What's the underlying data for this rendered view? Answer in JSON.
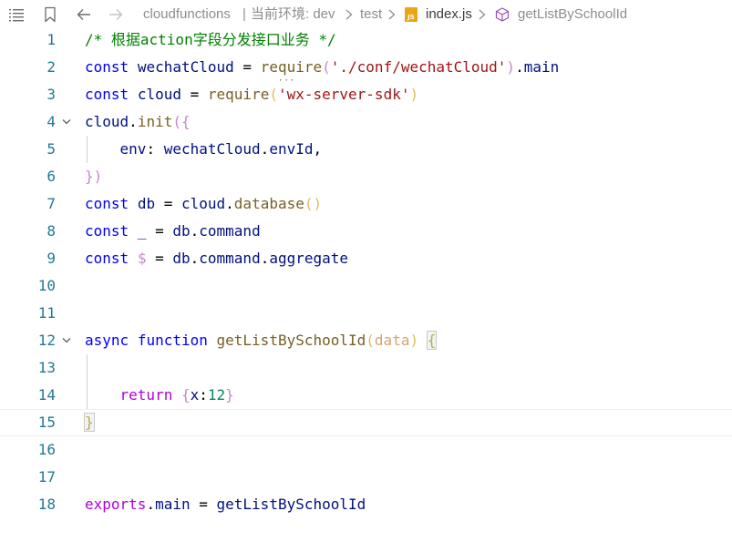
{
  "breadcrumb": {
    "project": "cloudfunctions",
    "separator_bar": "|",
    "env_label": "当前环境: dev",
    "folder": "test",
    "file_badge": "JS",
    "file": "index.js",
    "symbol": "getListBySchoolId"
  },
  "editor": {
    "current_line": 15,
    "lines": [
      {
        "num": "1",
        "tokens": [
          {
            "t": "/* 根据action字段分发接口业务 */",
            "c": "comment"
          }
        ]
      },
      {
        "num": "2",
        "tokens": [
          {
            "t": "const",
            "c": "kw"
          },
          {
            "t": " ",
            "c": "plain"
          },
          {
            "t": "wechatCloud",
            "c": "var"
          },
          {
            "t": " = ",
            "c": "plain"
          },
          {
            "t": "re",
            "c": "fn"
          },
          {
            "t": "q",
            "c": "fn",
            "ellipsis": true
          },
          {
            "t": "uire",
            "c": "fn"
          },
          {
            "t": "(",
            "c": "b5"
          },
          {
            "t": "'./conf/wechatCloud'",
            "c": "str"
          },
          {
            "t": ")",
            "c": "b5"
          },
          {
            "t": ".",
            "c": "plain"
          },
          {
            "t": "main",
            "c": "var"
          }
        ]
      },
      {
        "num": "3",
        "tokens": [
          {
            "t": "const",
            "c": "kw"
          },
          {
            "t": " ",
            "c": "plain"
          },
          {
            "t": "cloud",
            "c": "var"
          },
          {
            "t": " = ",
            "c": "plain"
          },
          {
            "t": "require",
            "c": "fn"
          },
          {
            "t": "(",
            "c": "b4"
          },
          {
            "t": "'wx-server-sdk'",
            "c": "str"
          },
          {
            "t": ")",
            "c": "b4"
          }
        ]
      },
      {
        "num": "4",
        "fold": true,
        "tokens": [
          {
            "t": "cloud",
            "c": "var"
          },
          {
            "t": ".",
            "c": "plain"
          },
          {
            "t": "init",
            "c": "fn"
          },
          {
            "t": "({",
            "c": "b5"
          }
        ]
      },
      {
        "num": "5",
        "guide": true,
        "tokens": [
          {
            "t": "    ",
            "c": "plain"
          },
          {
            "t": "env",
            "c": "var"
          },
          {
            "t": ": ",
            "c": "plain"
          },
          {
            "t": "wechatCloud",
            "c": "var"
          },
          {
            "t": ".",
            "c": "plain"
          },
          {
            "t": "envId",
            "c": "var"
          },
          {
            "t": ",",
            "c": "plain"
          }
        ]
      },
      {
        "num": "6",
        "tokens": [
          {
            "t": "})",
            "c": "b5"
          }
        ]
      },
      {
        "num": "7",
        "tokens": [
          {
            "t": "const",
            "c": "kw"
          },
          {
            "t": " ",
            "c": "plain"
          },
          {
            "t": "db",
            "c": "var"
          },
          {
            "t": " = ",
            "c": "plain"
          },
          {
            "t": "cloud",
            "c": "var"
          },
          {
            "t": ".",
            "c": "plain"
          },
          {
            "t": "database",
            "c": "fn"
          },
          {
            "t": "()",
            "c": "b4"
          }
        ]
      },
      {
        "num": "8",
        "tokens": [
          {
            "t": "const",
            "c": "kw"
          },
          {
            "t": " ",
            "c": "plain"
          },
          {
            "t": "_",
            "c": "var"
          },
          {
            "t": " = ",
            "c": "plain"
          },
          {
            "t": "db",
            "c": "var"
          },
          {
            "t": ".",
            "c": "plain"
          },
          {
            "t": "command",
            "c": "var"
          }
        ]
      },
      {
        "num": "9",
        "tokens": [
          {
            "t": "const",
            "c": "kw"
          },
          {
            "t": " ",
            "c": "plain"
          },
          {
            "t": "$",
            "c": "b5"
          },
          {
            "t": " = ",
            "c": "plain"
          },
          {
            "t": "db",
            "c": "var"
          },
          {
            "t": ".",
            "c": "plain"
          },
          {
            "t": "command",
            "c": "var"
          },
          {
            "t": ".",
            "c": "plain"
          },
          {
            "t": "aggregate",
            "c": "var"
          }
        ]
      },
      {
        "num": "10",
        "tokens": []
      },
      {
        "num": "11",
        "tokens": []
      },
      {
        "num": "12",
        "fold": true,
        "tokens": [
          {
            "t": "async",
            "c": "kw"
          },
          {
            "t": " ",
            "c": "plain"
          },
          {
            "t": "function",
            "c": "kw"
          },
          {
            "t": " ",
            "c": "plain"
          },
          {
            "t": "getListBySchoolId",
            "c": "fn"
          },
          {
            "t": "(",
            "c": "b4"
          },
          {
            "t": "data",
            "c": "param"
          },
          {
            "t": ")",
            "c": "b4"
          },
          {
            "t": " ",
            "c": "plain"
          },
          {
            "t": "{",
            "c": "boxed"
          }
        ]
      },
      {
        "num": "13",
        "guide": true,
        "tokens": []
      },
      {
        "num": "14",
        "guide": true,
        "tokens": [
          {
            "t": "    ",
            "c": "plain"
          },
          {
            "t": "return",
            "c": "ctrl"
          },
          {
            "t": " ",
            "c": "plain"
          },
          {
            "t": "{",
            "c": "b5"
          },
          {
            "t": "x",
            "c": "var"
          },
          {
            "t": ":",
            "c": "plain"
          },
          {
            "t": "12",
            "c": "num"
          },
          {
            "t": "}",
            "c": "b5"
          }
        ]
      },
      {
        "num": "15",
        "tokens": [
          {
            "t": "}",
            "c": "boxed"
          }
        ]
      },
      {
        "num": "16",
        "tokens": []
      },
      {
        "num": "17",
        "tokens": []
      },
      {
        "num": "18",
        "tokens": [
          {
            "t": "exports",
            "c": "ctrl"
          },
          {
            "t": ".",
            "c": "plain"
          },
          {
            "t": "main",
            "c": "var"
          },
          {
            "t": " = ",
            "c": "plain"
          },
          {
            "t": "getListBySchoolId",
            "c": "var"
          }
        ]
      }
    ]
  },
  "icons": [
    "outline-list-icon",
    "bookmark-icon",
    "back-arrow-icon",
    "forward-arrow-icon",
    "chevron-right-icon",
    "js-file-icon",
    "cube-symbol-icon",
    "fold-chevron-icon"
  ]
}
